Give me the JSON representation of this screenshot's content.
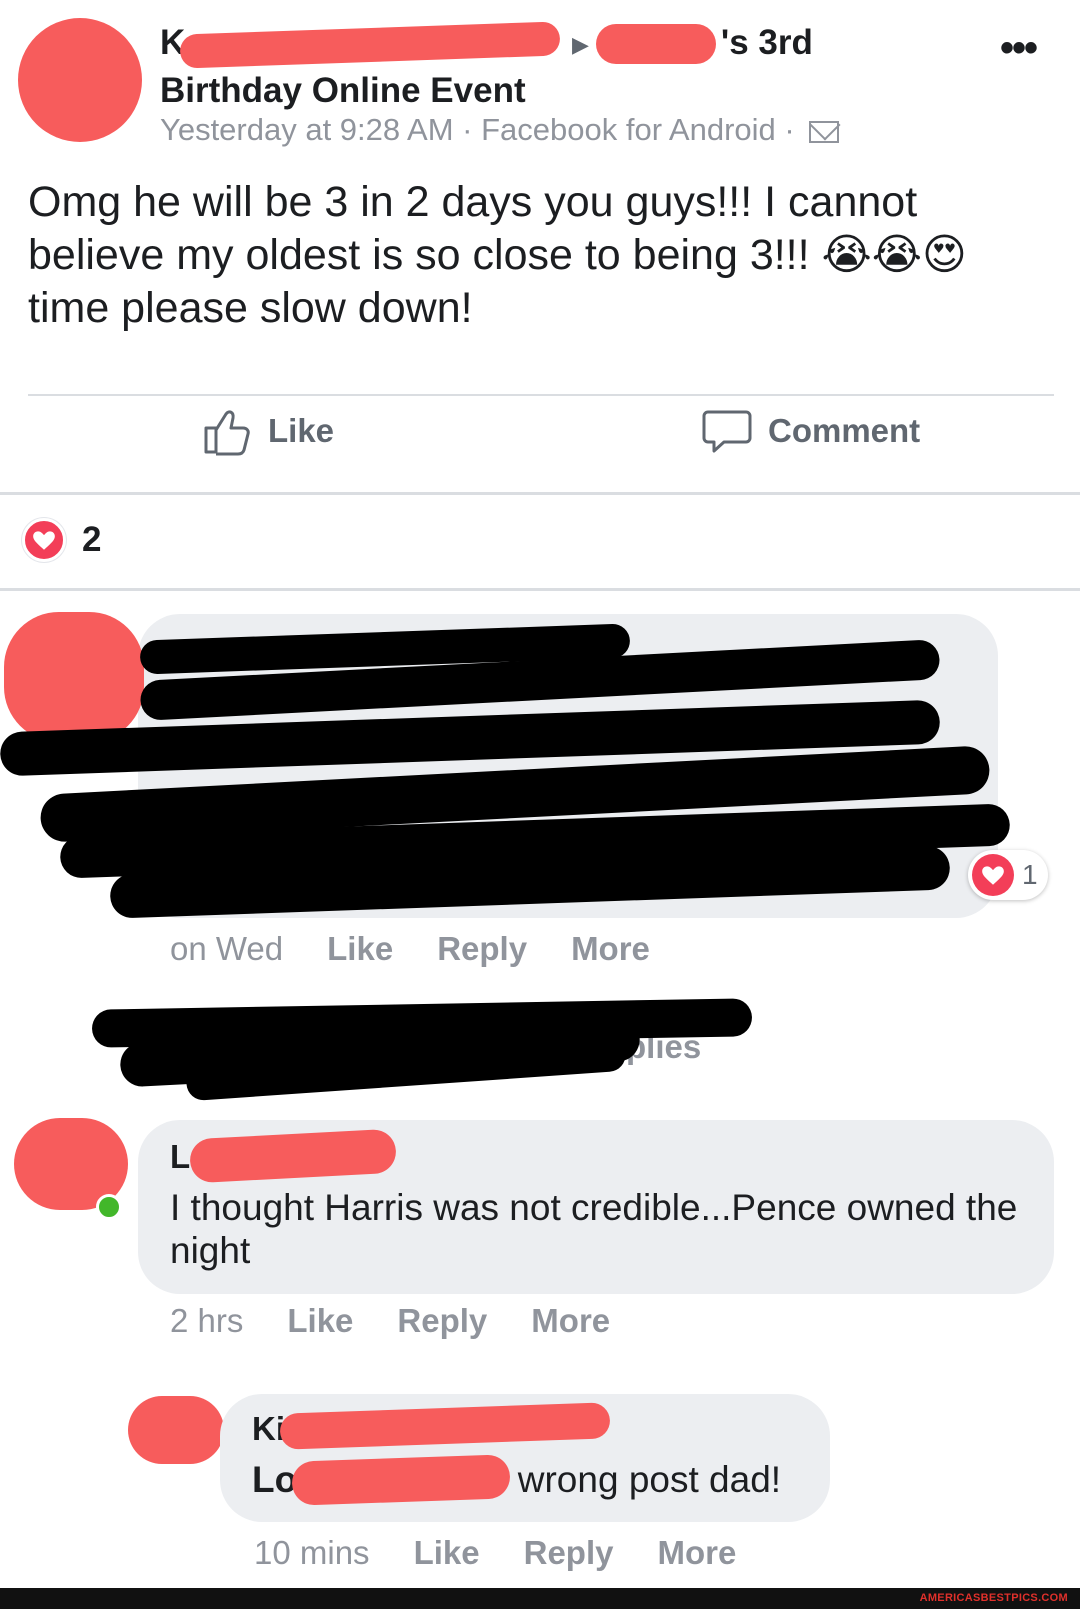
{
  "post": {
    "title_suffix": "'s 3rd",
    "title_line2": "Birthday Online Event",
    "meta": "Yesterday at 9:28 AM · Facebook for Android ·",
    "body": "Omg he will be 3 in 2 days you guys!!! I cannot believe my oldest is so close to being 3!!! 😭😭😍 time please slow down!",
    "more_label": "•••"
  },
  "actions": {
    "like_label": "Like",
    "comment_label": "Comment"
  },
  "reactions": {
    "count": "2"
  },
  "comment1": {
    "time": "on Wed",
    "like": "Like",
    "reply": "Reply",
    "more": "More",
    "reaction_count": "1"
  },
  "replies_link": {
    "fragment": "plies"
  },
  "comment2": {
    "name_initial": "L",
    "text": "I thought Harris was not credible...Pence owned the night",
    "time": "2 hrs",
    "like": "Like",
    "reply": "Reply",
    "more": "More"
  },
  "comment3": {
    "name_initial": "Ki",
    "text_prefix": "Lo",
    "text_suffix": "wrong post dad!",
    "time": "10 mins",
    "like": "Like",
    "reply": "Reply",
    "more": "More"
  },
  "watermark": "AMERICASBESTPICS.COM",
  "colors": {
    "redaction_red": "#f75c5c",
    "heart_red": "#f33e58",
    "online_green": "#42b72a",
    "meta_gray": "#90949c"
  }
}
